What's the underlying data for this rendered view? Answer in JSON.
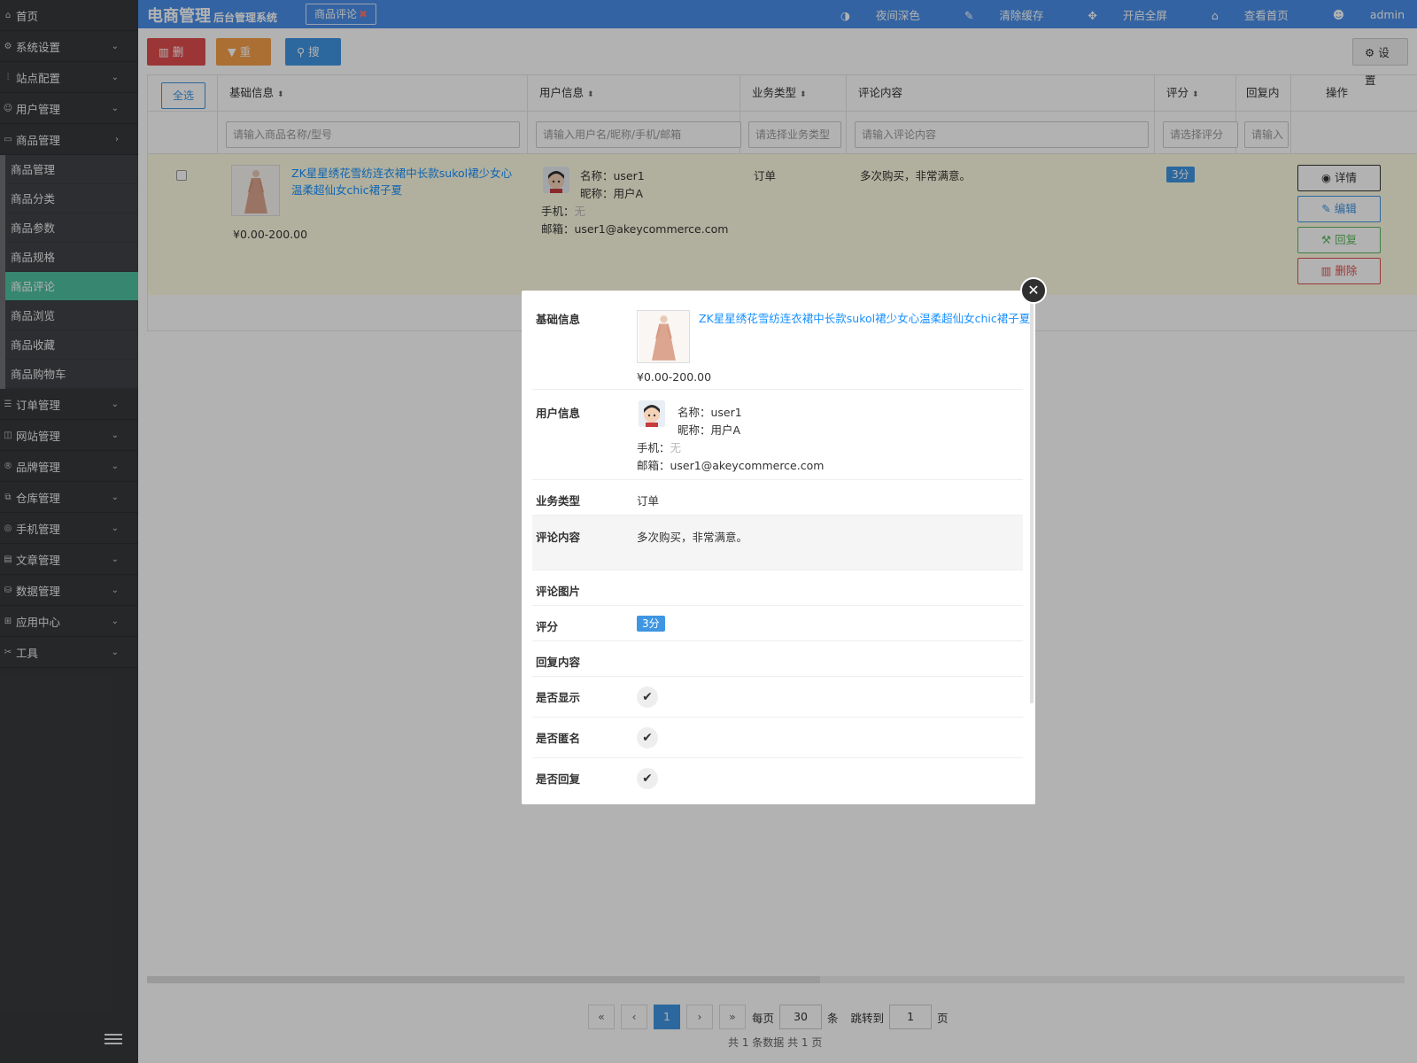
{
  "topbar": {
    "brand_title": "电商管理",
    "brand_subtitle": "后台管理系统",
    "tab_label": "商品评论",
    "links": [
      "夜间深色",
      "清除缓存",
      "开启全屏",
      "查看首页",
      "admin"
    ]
  },
  "sidebar": {
    "home": "首页",
    "groups_top": [
      "系统设置",
      "站点配置",
      "用户管理"
    ],
    "goods_group": "商品管理",
    "goods_sub": [
      "商品管理",
      "商品分类",
      "商品参数",
      "商品规格",
      "商品评论",
      "商品浏览",
      "商品收藏",
      "商品购物车"
    ],
    "active_sub": "商品评论",
    "groups_bottom": [
      "订单管理",
      "网站管理",
      "品牌管理",
      "仓库管理",
      "手机管理",
      "文章管理",
      "数据管理",
      "应用中心",
      "工具"
    ]
  },
  "toolbar": {
    "delete": "删除",
    "reset": "重置",
    "search": "搜索",
    "settings": "设置"
  },
  "table": {
    "select_all": "全选",
    "columns": [
      "基础信息",
      "用户信息",
      "业务类型",
      "评论内容",
      "评分",
      "回复内",
      "操作"
    ],
    "filters": [
      "请输入商品名称/型号",
      "请输入用户名/昵称/手机/邮箱",
      "请选择业务类型",
      "请输入评论内容",
      "请选择评分",
      "请输入"
    ],
    "row": {
      "goods_title": "ZK星星绣花雪纺连衣裙中长款sukol裙少女心温柔超仙女chic裙子夏",
      "price": "¥0.00-200.00",
      "user_name": "名称：user1",
      "user_nick": "昵称：用户A",
      "user_phone_label": "手机：",
      "user_phone_value": "无",
      "user_email": "邮箱：user1@akeycommerce.com",
      "business_type": "订单",
      "content": "多次购买，非常满意。",
      "rating": "3分"
    },
    "actions": [
      "详情",
      "编辑",
      "回复",
      "删除"
    ]
  },
  "pagination": {
    "current": "1",
    "per_page_label": "每页",
    "per_page": "30",
    "per_page_unit": "条",
    "jump_label": "跳转到",
    "jump_page": "1",
    "jump_unit": "页",
    "total": "共 1 条数据 共 1 页"
  },
  "modal": {
    "labels": [
      "基础信息",
      "用户信息",
      "业务类型",
      "评论内容",
      "评论图片",
      "评分",
      "回复内容",
      "是否显示",
      "是否匿名",
      "是否回复"
    ],
    "goods_title": "ZK星星绣花雪纺连衣裙中长款sukol裙少女心温柔超仙女chic裙子夏",
    "price": "¥0.00-200.00",
    "user_name": "名称：user1",
    "user_nick": "昵称：用户A",
    "user_phone_label": "手机：",
    "user_phone_value": "无",
    "user_email": "邮箱：user1@akeycommerce.com",
    "business_type": "订单",
    "content": "多次购买，非常满意。",
    "rating": "3分"
  },
  "colors": {
    "topbar": "#4a8fe8",
    "sidebar": "#36393c",
    "active_menu": "#4fc0a0",
    "primary": "#3f96e2",
    "danger": "#e04e4e",
    "warning": "#f5a04a"
  }
}
